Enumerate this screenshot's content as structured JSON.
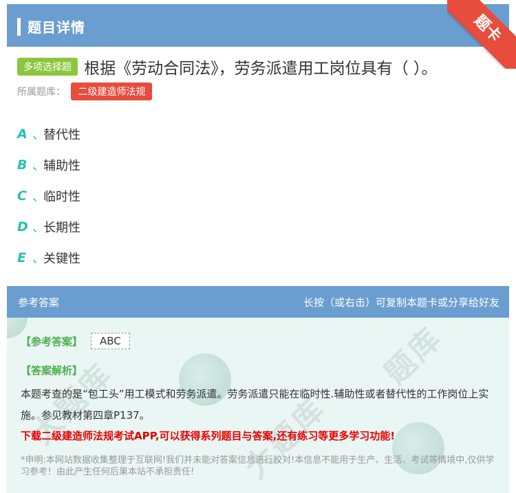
{
  "header": {
    "title": "题目详情",
    "corner_badge": "题卡"
  },
  "question": {
    "type_badge": "多项选择题",
    "text": "根据《劳动合同法》，劳务派遣用工岗位具有（ ）。",
    "library_label": "所属题库：",
    "library_name": "二级建造师法规"
  },
  "options": [
    {
      "letter": "A",
      "sep": "、",
      "text": "替代性"
    },
    {
      "letter": "B",
      "sep": "、",
      "text": "辅助性"
    },
    {
      "letter": "C",
      "sep": "、",
      "text": "临时性"
    },
    {
      "letter": "D",
      "sep": "、",
      "text": "长期性"
    },
    {
      "letter": "E",
      "sep": "、",
      "text": "关键性"
    }
  ],
  "answer_panel": {
    "title": "参考答案",
    "hint": "长按（或右击）可复制本题卡或分享给好友",
    "answer_label": "【参考答案】",
    "answer_value": "ABC",
    "analysis_label": "【答案解析】",
    "analysis_text": "本题考查的是“包工头”用工模式和劳务派遣。劳务派遣只能在临时性.辅助性或者替代性的工作岗位上实施。参见教材第四章P137。",
    "promo": "下载二级建造师法规考试APP,可以获得系列题目与答案,还有练习等更多学习功能!",
    "disclaimer": "*申明:本网站数据收集整理于互联网!我们并未能对答案信息进行校对!本信息不能用于生产、生活、考试等情境中,仅供学习参考！由此产生任何后果本站不承担责任!"
  },
  "colors": {
    "header_bg": "#6a9ed0",
    "accent_teal": "#2bbfae",
    "badge_green": "#8cc63f",
    "badge_red": "#e84c3d",
    "promo_red": "#e60000",
    "panel_bg": "#eaf6f3"
  }
}
